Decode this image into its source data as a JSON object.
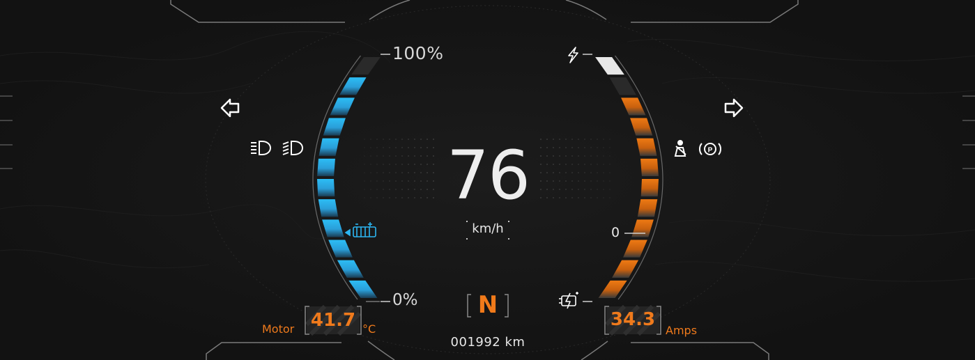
{
  "battery_gauge": {
    "top_label": "100%",
    "bottom_label": "0%",
    "level": 0.95
  },
  "power_gauge": {
    "regen_value": "0",
    "level": 0.82
  },
  "speed": {
    "value": "76",
    "unit": "km/h"
  },
  "gear": {
    "value": "N"
  },
  "odometer": {
    "value": "001992 km"
  },
  "motor_temp": {
    "label": "Motor",
    "value": "41.7",
    "unit": "°C"
  },
  "current": {
    "value": "34.3",
    "unit": "Amps"
  },
  "indicators": {
    "left": [
      "turn-left-icon",
      "low-beam-icon",
      "high-beam-icon",
      "battery-warning-icon"
    ],
    "right": [
      "turn-right-icon",
      "seatbelt-icon",
      "parking-brake-icon",
      "power-icon",
      "charging-icon"
    ]
  },
  "colors": {
    "accent": "#f07a1a",
    "battery": "#29b6f6",
    "background": "#141414",
    "text": "#e8e8e8"
  }
}
